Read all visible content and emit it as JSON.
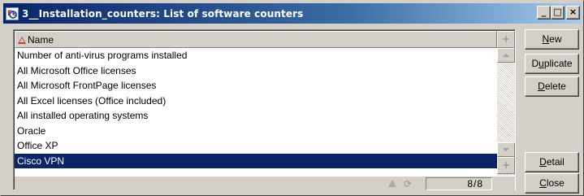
{
  "window": {
    "title": "3__Installation_counters: List of software counters",
    "icon": "fe-table-icon",
    "controls": {
      "minimize": "_",
      "maximize": "□",
      "close": "×"
    }
  },
  "list": {
    "column_header": "Name",
    "sort_icon": "sort-ascending-icon",
    "rows": [
      "Number of anti-virus programs installed",
      "All Microsoft Office licenses",
      "All Microsoft FrontPage licenses",
      "All Excel licenses (Office included)",
      "All installed operating systems",
      "Oracle",
      "Office XP",
      "Cisco VPN"
    ],
    "selected_index": 7,
    "selection_color": "#0a246a",
    "scroll_plus_top": "+",
    "scroll_plus_bottom": "+"
  },
  "status": {
    "count": "8/8"
  },
  "buttons": {
    "new": {
      "hotkey": "N",
      "rest": "ew"
    },
    "duplicate": {
      "pre": "D",
      "hotkey": "u",
      "rest": "plicate"
    },
    "delete": {
      "hotkey": "D",
      "rest": "elete"
    },
    "detail": {
      "hotkey": "D",
      "rest": "etail"
    },
    "close": {
      "hotkey": "C",
      "rest": "lose"
    }
  }
}
